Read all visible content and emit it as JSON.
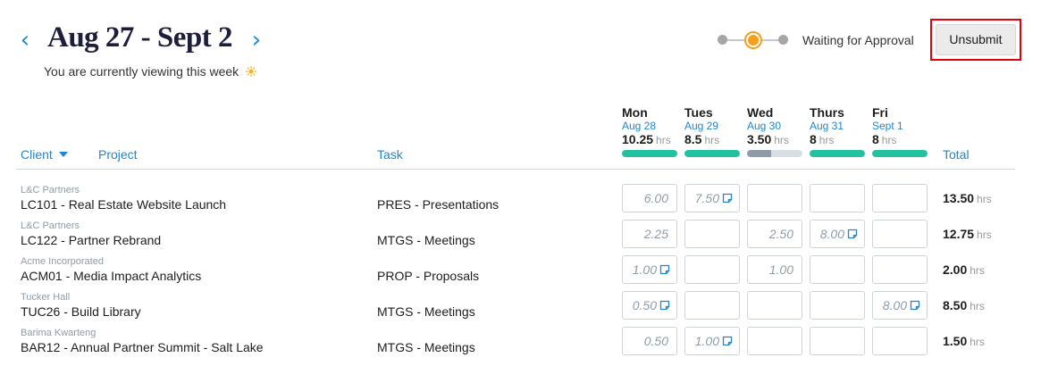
{
  "header": {
    "title": "Aug 27 - Sept 2",
    "subtitle": "You are currently viewing this week",
    "prev_label": "‹",
    "next_label": "›"
  },
  "status": {
    "label": "Waiting for Approval",
    "active_step": 2,
    "step_count": 3,
    "colors": {
      "active": "#f79e1b",
      "inactive": "#a6a6a6"
    }
  },
  "actions": {
    "unsubmit_label": "Unsubmit"
  },
  "columns": {
    "client": "Client",
    "project": "Project",
    "task": "Task",
    "total": "Total"
  },
  "days": [
    {
      "name": "Mon",
      "date": "Aug 28",
      "hours": "10.25",
      "unit": "hrs",
      "bar_fill": 1.0,
      "bar_color": "#22c2a1"
    },
    {
      "name": "Tues",
      "date": "Aug 29",
      "hours": "8.5",
      "unit": "hrs",
      "bar_fill": 1.0,
      "bar_color": "#22c2a1"
    },
    {
      "name": "Wed",
      "date": "Aug 30",
      "hours": "3.50",
      "unit": "hrs",
      "bar_fill": 0.4375,
      "bar_color": "#8f9ca8"
    },
    {
      "name": "Thurs",
      "date": "Aug 31",
      "hours": "8",
      "unit": "hrs",
      "bar_fill": 1.0,
      "bar_color": "#22c2a1"
    },
    {
      "name": "Fri",
      "date": "Sept 1",
      "hours": "8",
      "unit": "hrs",
      "bar_fill": 1.0,
      "bar_color": "#22c2a1"
    }
  ],
  "rows": [
    {
      "client": "L&C Partners",
      "project": "LC101 - Real Estate Website Launch",
      "task": "PRES - Presentations",
      "cells": [
        {
          "value": "6.00",
          "note": false
        },
        {
          "value": "7.50",
          "note": true
        },
        {
          "value": "",
          "note": false
        },
        {
          "value": "",
          "note": false
        },
        {
          "value": "",
          "note": false
        }
      ],
      "total": "13.50",
      "total_unit": "hrs"
    },
    {
      "client": "L&C Partners",
      "project": "LC122 - Partner Rebrand",
      "task": "MTGS - Meetings",
      "cells": [
        {
          "value": "2.25",
          "note": false
        },
        {
          "value": "",
          "note": false
        },
        {
          "value": "2.50",
          "note": false
        },
        {
          "value": "8.00",
          "note": true
        },
        {
          "value": "",
          "note": false
        }
      ],
      "total": "12.75",
      "total_unit": "hrs"
    },
    {
      "client": "Acme Incorporated",
      "project": "ACM01 - Media Impact Analytics",
      "task": "PROP - Proposals",
      "cells": [
        {
          "value": "1.00",
          "note": true
        },
        {
          "value": "",
          "note": false
        },
        {
          "value": "1.00",
          "note": false
        },
        {
          "value": "",
          "note": false
        },
        {
          "value": "",
          "note": false
        }
      ],
      "total": "2.00",
      "total_unit": "hrs"
    },
    {
      "client": "Tucker Hall",
      "project": "TUC26 - Build Library",
      "task": "MTGS - Meetings",
      "cells": [
        {
          "value": "0.50",
          "note": true
        },
        {
          "value": "",
          "note": false
        },
        {
          "value": "",
          "note": false
        },
        {
          "value": "",
          "note": false
        },
        {
          "value": "8.00",
          "note": true
        }
      ],
      "total": "8.50",
      "total_unit": "hrs"
    },
    {
      "client": "Barima Kwarteng",
      "project": "BAR12 - Annual Partner Summit - Salt Lake",
      "task": "MTGS - Meetings",
      "cells": [
        {
          "value": "0.50",
          "note": false
        },
        {
          "value": "1.00",
          "note": true
        },
        {
          "value": "",
          "note": false
        },
        {
          "value": "",
          "note": false
        },
        {
          "value": "",
          "note": false
        }
      ],
      "total": "1.50",
      "total_unit": "hrs"
    }
  ],
  "colors": {
    "accent": "#1d87d5",
    "complete": "#22c2a1",
    "partial": "#8f9ca8",
    "highlight": "#e0000b"
  },
  "icons": {
    "sun": "sun-icon",
    "note": "note-icon",
    "caret": "caret-down-icon"
  }
}
